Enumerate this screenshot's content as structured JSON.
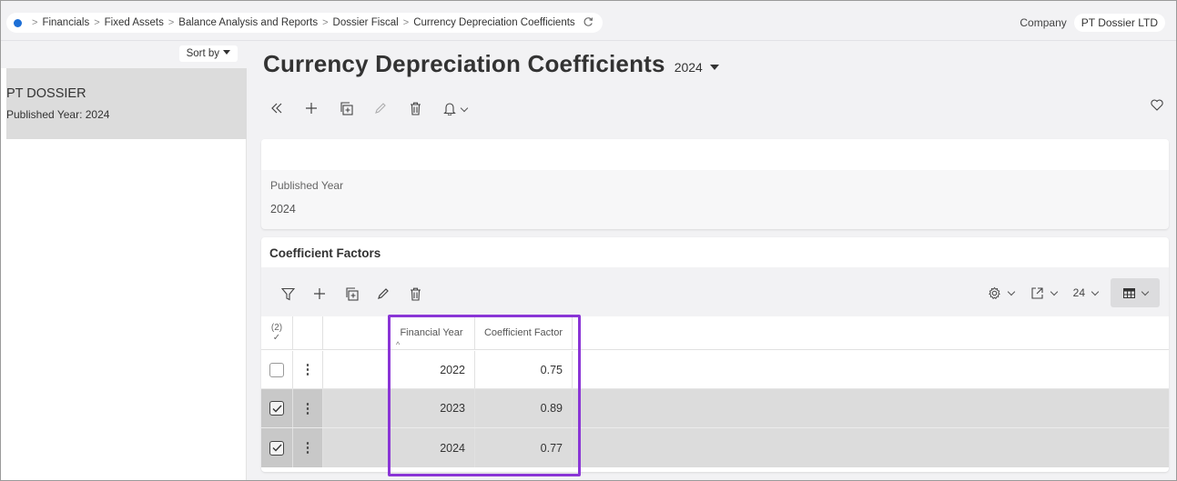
{
  "breadcrumb": {
    "items": [
      "Financials",
      "Fixed Assets",
      "Balance Analysis and Reports",
      "Dossier Fiscal",
      "Currency Depreciation Coefficients"
    ]
  },
  "company": {
    "label": "Company",
    "value": "PT Dossier LTD"
  },
  "sidebar": {
    "sort_label": "Sort by",
    "items": [
      {
        "title": "PT DOSSIER",
        "subtitle": "Published Year:  2024"
      }
    ]
  },
  "page": {
    "title": "Currency Depreciation Coefficients",
    "selected_year": "2024"
  },
  "header_card": {
    "field_label": "Published Year",
    "field_value": "2024"
  },
  "coefficients": {
    "title": "Coefficient Factors",
    "page_size": "24",
    "selected_count": "(2)",
    "columns": [
      "Financial Year",
      "Coefficient Factor"
    ],
    "rows": [
      {
        "year": "2022",
        "factor": "0.75",
        "checked": false
      },
      {
        "year": "2023",
        "factor": "0.89",
        "checked": true
      },
      {
        "year": "2024",
        "factor": "0.77",
        "checked": true
      }
    ]
  },
  "colors": {
    "accent": "#1d6fd6",
    "highlight": "#8a35d6",
    "selected_row": "#dcdcdc"
  }
}
